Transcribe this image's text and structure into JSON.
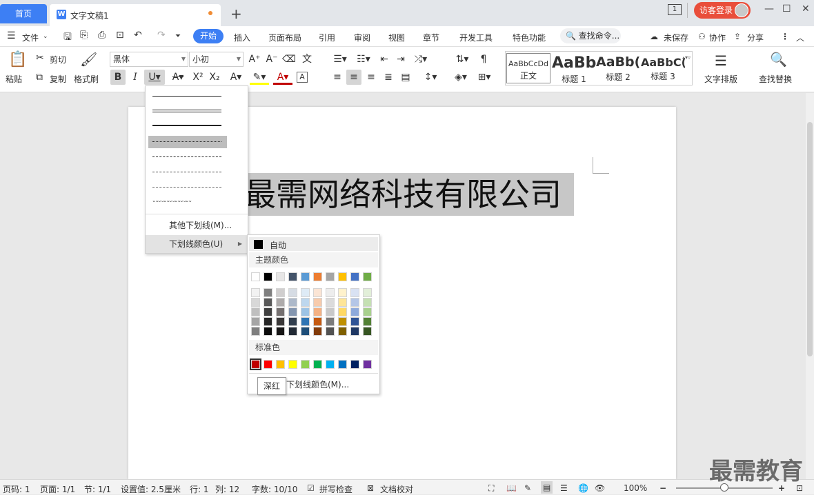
{
  "tabs": {
    "home": "首页",
    "doc": "文字文稿1",
    "add": "+"
  },
  "window": {
    "guest": "访客登录",
    "restore_box": "1",
    "minimize": "—",
    "maximize": "☐",
    "close": "✕"
  },
  "menu": {
    "file": "文件",
    "ribbon_tabs": [
      "开始",
      "插入",
      "页面布局",
      "引用",
      "审阅",
      "视图",
      "章节",
      "开发工具",
      "特色功能"
    ],
    "search": "查找命令...",
    "unsaved": "未保存",
    "collab": "协作",
    "share": "分享"
  },
  "ribbon": {
    "paste": "粘贴",
    "cut": "剪切",
    "copy": "复制",
    "format_painter": "格式刷",
    "font": "黑体",
    "size": "小初",
    "styles": [
      {
        "preview": "AaBbCcDd",
        "name": "正文"
      },
      {
        "preview": "AaBb",
        "name": "标题 1"
      },
      {
        "preview": "AaBb(",
        "name": "标题 2"
      },
      {
        "preview": "AaBbC(",
        "name": "标题 3"
      }
    ],
    "text_layout": "文字排版",
    "find_replace": "查找替换"
  },
  "document": {
    "heading": "最需网络科技有限公司"
  },
  "underline_menu": {
    "other": "其他下划线(M)...",
    "color": "下划线颜色(U)"
  },
  "color_menu": {
    "auto": "自动",
    "theme_label": "主题颜色",
    "standard_label": "标准色",
    "more": "下划线颜色(M)...",
    "theme_top": [
      "#ffffff",
      "#000000",
      "#e7e6e6",
      "#44546a",
      "#5b9bd5",
      "#ed7d31",
      "#a5a5a5",
      "#ffc000",
      "#4472c4",
      "#70ad47"
    ],
    "theme_shades": [
      [
        "#f2f2f2",
        "#7f7f7f",
        "#d0cece",
        "#d6dce4",
        "#deebf6",
        "#fbe5d5",
        "#ededed",
        "#fff2cc",
        "#d9e2f3",
        "#e2efd9"
      ],
      [
        "#d8d8d8",
        "#595959",
        "#aeabab",
        "#adb9ca",
        "#bdd7ee",
        "#f7cbac",
        "#dbdbdb",
        "#fee599",
        "#b4c6e7",
        "#c5e0b3"
      ],
      [
        "#bfbfbf",
        "#3f3f3f",
        "#757070",
        "#8496b0",
        "#9cc3e5",
        "#f4b183",
        "#c9c9c9",
        "#ffd965",
        "#8eaadb",
        "#a8d08d"
      ],
      [
        "#a5a5a5",
        "#262626",
        "#3a3838",
        "#323f4f",
        "#2e75b5",
        "#c55a11",
        "#7b7b7b",
        "#bf9000",
        "#2f5496",
        "#538135"
      ],
      [
        "#7f7f7f",
        "#0c0c0c",
        "#171616",
        "#222a35",
        "#1e4e79",
        "#833c0b",
        "#525252",
        "#7f6000",
        "#1f3864",
        "#375623"
      ]
    ],
    "standard": [
      "#c00000",
      "#ff0000",
      "#ffc000",
      "#ffff00",
      "#92d050",
      "#00b050",
      "#00b0f0",
      "#0070c0",
      "#002060",
      "#7030a0"
    ]
  },
  "tooltip": "深红",
  "status": {
    "page": "页码: 1",
    "pages": "页面: 1/1",
    "section": "节: 1/1",
    "setting": "设置值: 2.5厘米",
    "row": "行: 1",
    "col": "列: 12",
    "words": "字数: 10/10",
    "spell": "拼写检查",
    "proof": "文档校对",
    "zoom": "100%",
    "zoom_level": 0.5
  },
  "watermark": "最需教育"
}
